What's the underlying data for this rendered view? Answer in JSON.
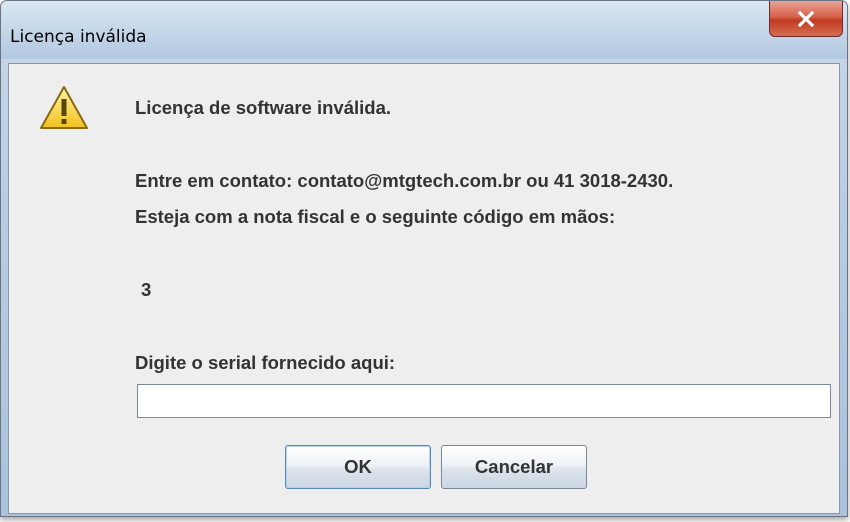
{
  "window": {
    "title": "Licença inválida"
  },
  "dialog": {
    "message_title": "Licença de software inválida.",
    "contact_line": "Entre em contato: contato@mtgtech.com.br ou 41 3018-2430.",
    "instruction_line": "Esteja com a nota fiscal e o seguinte código em mãos:",
    "code": "3",
    "serial_label": "Digite o serial fornecido aqui:",
    "serial_value": ""
  },
  "buttons": {
    "ok_label": "OK",
    "cancel_label": "Cancelar"
  },
  "icons": {
    "warning": "warning-icon",
    "close": "close-icon"
  },
  "colors": {
    "close_button": "#c94a35",
    "warning_fill": "#f7d23c",
    "text": "#333333"
  }
}
